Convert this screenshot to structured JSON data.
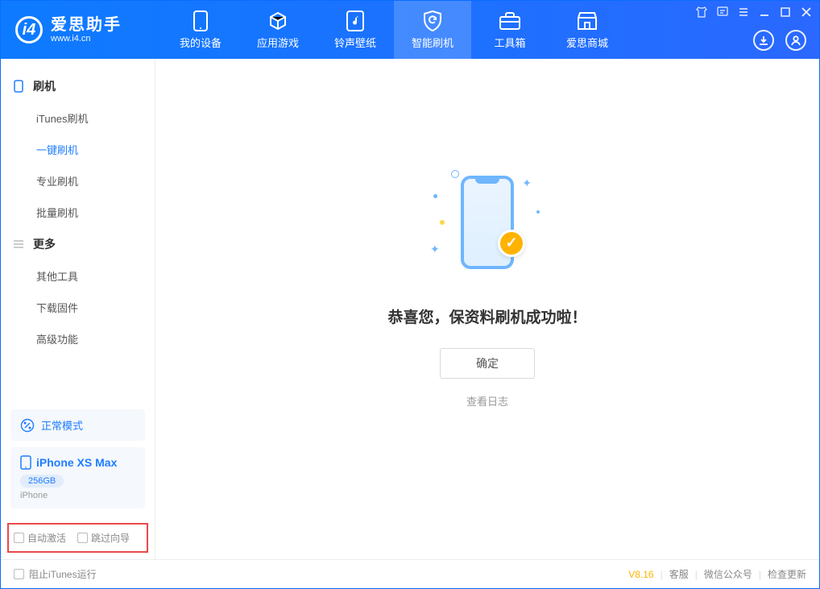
{
  "app": {
    "title": "爱思助手",
    "subtitle": "www.i4.cn"
  },
  "nav": {
    "tabs": [
      {
        "label": "我的设备"
      },
      {
        "label": "应用游戏"
      },
      {
        "label": "铃声壁纸"
      },
      {
        "label": "智能刷机"
      },
      {
        "label": "工具箱"
      },
      {
        "label": "爱思商城"
      }
    ],
    "active_index": 3
  },
  "sidebar": {
    "group1": {
      "title": "刷机",
      "items": [
        {
          "label": "iTunes刷机"
        },
        {
          "label": "一键刷机"
        },
        {
          "label": "专业刷机"
        },
        {
          "label": "批量刷机"
        }
      ],
      "active_index": 1
    },
    "group2": {
      "title": "更多",
      "items": [
        {
          "label": "其他工具"
        },
        {
          "label": "下载固件"
        },
        {
          "label": "高级功能"
        }
      ]
    },
    "mode": "正常模式",
    "device": {
      "name": "iPhone XS Max",
      "capacity": "256GB",
      "type": "iPhone"
    },
    "checks": {
      "auto_activate": "自动激活",
      "skip_guide": "跳过向导"
    }
  },
  "content": {
    "success_text": "恭喜您，保资料刷机成功啦！",
    "confirm_btn": "确定",
    "view_log": "查看日志"
  },
  "footer": {
    "block_itunes": "阻止iTunes运行",
    "version": "V8.16",
    "links": {
      "support": "客服",
      "wechat": "微信公众号",
      "update": "检查更新"
    }
  },
  "colors": {
    "primary": "#1e7dff",
    "accent": "#ffb300",
    "highlight_border": "#e94b4b"
  }
}
